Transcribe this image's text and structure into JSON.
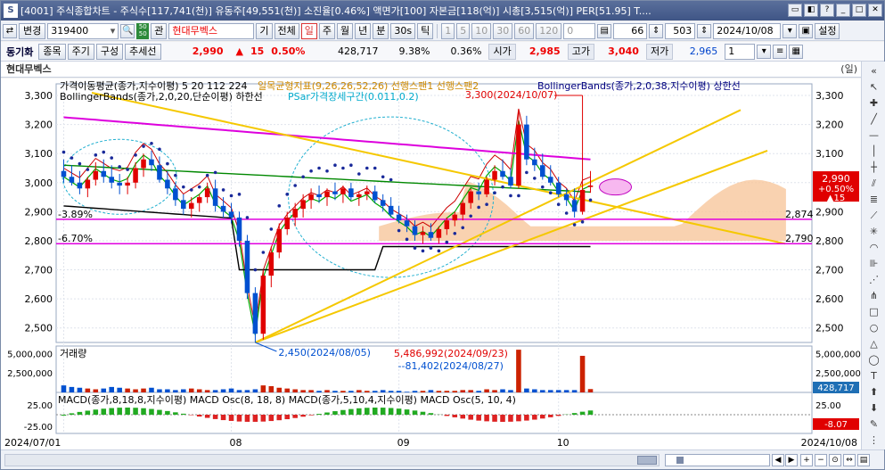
{
  "window": {
    "app_icon": "S",
    "title": "[4001] 주식종합차트 - 주식수[117,741(천)] 유동주[49,551(천)] 소진율[0.46%] 액면가[100] 자본금[118(억)] 시총[3,515(억)] PER[51.95] T...."
  },
  "toolbar1": {
    "change_label": "변경",
    "code": "319400",
    "market_top": "50",
    "market_bottom": "50",
    "gwan": "관",
    "stock_name": "현대무벡스",
    "gi": "기",
    "all": "전체",
    "periods": [
      "일",
      "주",
      "월",
      "년",
      "분",
      "30s",
      "틱"
    ],
    "intervals": [
      "1",
      "5",
      "10",
      "30",
      "60",
      "120",
      "0"
    ],
    "count_a": "66",
    "count_b": "503",
    "date": "2024/10/08",
    "settings": "설정"
  },
  "toolbar2": {
    "tag": "동기화",
    "buttons": [
      "종목",
      "주기",
      "구성",
      "추세선"
    ],
    "price": "2,990",
    "change_arrow": "▲",
    "change": "15",
    "change_rate": "0.50%",
    "volume": "428,717",
    "turnover": "9.38%",
    "vs_rate": "0.36%",
    "open_label": "시가",
    "open": "2,985",
    "high_label": "고가",
    "high": "3,040",
    "low_label": "저가",
    "low": "2,965",
    "page": "1"
  },
  "chart_header": {
    "stock": "현대무벡스",
    "unit": "(일)"
  },
  "chart_data": {
    "type": "candlestick",
    "title": "",
    "legend_main": [
      {
        "text": "가격이동평균(종가,지수이평) 5 20 112 224",
        "color": "#000000"
      },
      {
        "text": "일목균형지표(9,26,26,52,26) 선행스팬1 선행스팬2",
        "color": "#cc8800"
      },
      {
        "text": "BollingerBands(종가,2,0,38,지수이평) 상한선",
        "color": "#000080"
      },
      {
        "text": "BollingerBands(종가,2,0,20,단순이평) 하한선",
        "color": "#000000"
      },
      {
        "text": "PSar가격장세구간(0.011,0.2)",
        "color": "#00aacc"
      }
    ],
    "price_axis": [
      3300,
      3200,
      3100,
      3000,
      2900,
      2800,
      2700,
      2600,
      2500
    ],
    "price_ylim": [
      2450,
      3340
    ],
    "x_labels": [
      "2024/07/01",
      "08",
      "09",
      "10",
      "2024/10/08"
    ],
    "last_price": 2990,
    "last_change": "+0.50%",
    "last_delta": "▲15",
    "hlines": [
      {
        "label": "3.89%",
        "value": 2874,
        "value_label": "2,874"
      },
      {
        "label": "6.70%",
        "value": 2790,
        "value_label": "2,790"
      }
    ],
    "annotations": [
      {
        "text": "3,300(2024/10/07)",
        "value": 3300
      },
      {
        "text": "2,450(2024/08/05)",
        "value": 2450
      }
    ],
    "volume": {
      "label": "거래량",
      "axis": [
        "5,000,000",
        "2,500,000"
      ],
      "max_annotation": "5,486,992(2024/09/23)",
      "min_annotation": "81,402(2024/08/27)",
      "last": "428,717",
      "values": [
        900000,
        700000,
        600000,
        500000,
        400000,
        500000,
        700000,
        600000,
        500000,
        400000,
        500000,
        600000,
        400000,
        400000,
        300000,
        400000,
        500000,
        400000,
        300000,
        300000,
        400000,
        500000,
        300000,
        300000,
        400000,
        900000,
        800000,
        600000,
        500000,
        400000,
        300000,
        300000,
        200000,
        300000,
        200000,
        200000,
        200000,
        300000,
        200000,
        200000,
        300000,
        200000,
        200000,
        81402,
        200000,
        200000,
        300000,
        200000,
        200000,
        200000,
        300000,
        300000,
        200000,
        400000,
        300000,
        400000,
        300000,
        5486992,
        500000,
        400000,
        300000,
        300000,
        300000,
        300000,
        300000,
        4700000,
        428717
      ]
    },
    "macd": {
      "label": "MACD(종가,8,18,8,지수이평) MACD Osc(8, 18, 8) MACD(종가,5,10,4,지수이평) MACD Osc(5, 10, 4)",
      "axis": [
        "25.00",
        "-25.00"
      ],
      "last": "-8.07"
    },
    "candles": [
      [
        3040,
        3080,
        3000,
        3020
      ],
      [
        3020,
        3060,
        2990,
        3000
      ],
      [
        3000,
        3040,
        2960,
        2980
      ],
      [
        2980,
        3020,
        2950,
        3010
      ],
      [
        3010,
        3070,
        2990,
        3040
      ],
      [
        3040,
        3080,
        3000,
        3020
      ],
      [
        3020,
        3060,
        2980,
        3000
      ],
      [
        3000,
        3030,
        2960,
        2990
      ],
      [
        2990,
        3020,
        2960,
        3000
      ],
      [
        3000,
        3070,
        2980,
        3050
      ],
      [
        3050,
        3100,
        3020,
        3080
      ],
      [
        3080,
        3110,
        3040,
        3060
      ],
      [
        3060,
        3090,
        3000,
        3010
      ],
      [
        3010,
        3040,
        2960,
        2980
      ],
      [
        2980,
        3000,
        2920,
        2940
      ],
      [
        2940,
        2960,
        2890,
        2910
      ],
      [
        2910,
        2950,
        2880,
        2930
      ],
      [
        2930,
        2960,
        2900,
        2950
      ],
      [
        2950,
        3000,
        2930,
        2980
      ],
      [
        2980,
        3010,
        2900,
        2920
      ],
      [
        2920,
        2950,
        2880,
        2900
      ],
      [
        2900,
        2930,
        2860,
        2880
      ],
      [
        2880,
        2900,
        2780,
        2800
      ],
      [
        2800,
        2820,
        2600,
        2620
      ],
      [
        2620,
        2640,
        2450,
        2480
      ],
      [
        2480,
        2700,
        2460,
        2680
      ],
      [
        2680,
        2780,
        2640,
        2760
      ],
      [
        2760,
        2860,
        2740,
        2840
      ],
      [
        2840,
        2900,
        2820,
        2880
      ],
      [
        2880,
        2930,
        2850,
        2910
      ],
      [
        2910,
        2960,
        2880,
        2940
      ],
      [
        2940,
        2980,
        2910,
        2960
      ],
      [
        2960,
        2990,
        2930,
        2950
      ],
      [
        2950,
        2980,
        2920,
        2970
      ],
      [
        2970,
        3000,
        2940,
        2960
      ],
      [
        2960,
        2990,
        2930,
        2980
      ],
      [
        2980,
        3000,
        2940,
        2950
      ],
      [
        2950,
        2970,
        2920,
        2960
      ],
      [
        2960,
        2990,
        2940,
        2970
      ],
      [
        2970,
        2990,
        2930,
        2940
      ],
      [
        2940,
        2960,
        2900,
        2920
      ],
      [
        2920,
        2950,
        2880,
        2890
      ],
      [
        2890,
        2920,
        2860,
        2870
      ],
      [
        2870,
        2890,
        2830,
        2850
      ],
      [
        2850,
        2870,
        2800,
        2820
      ],
      [
        2820,
        2850,
        2790,
        2830
      ],
      [
        2830,
        2860,
        2800,
        2810
      ],
      [
        2810,
        2850,
        2790,
        2840
      ],
      [
        2840,
        2880,
        2820,
        2870
      ],
      [
        2870,
        2900,
        2850,
        2890
      ],
      [
        2890,
        2940,
        2870,
        2930
      ],
      [
        2930,
        2980,
        2910,
        2970
      ],
      [
        2970,
        3000,
        2940,
        2960
      ],
      [
        2960,
        3020,
        2950,
        3010
      ],
      [
        3010,
        3060,
        2990,
        3040
      ],
      [
        3040,
        3080,
        3010,
        3020
      ],
      [
        3020,
        3050,
        2980,
        2990
      ],
      [
        2990,
        3250,
        2980,
        3200
      ],
      [
        3200,
        3230,
        3060,
        3080
      ],
      [
        3080,
        3120,
        3040,
        3060
      ],
      [
        3060,
        3100,
        3010,
        3020
      ],
      [
        3020,
        3060,
        2990,
        3000
      ],
      [
        3000,
        3020,
        2950,
        2960
      ],
      [
        2960,
        2980,
        2920,
        2940
      ],
      [
        2940,
        2980,
        2880,
        2900
      ],
      [
        2900,
        3300,
        2890,
        2975
      ],
      [
        2985,
        3040,
        2965,
        2990
      ]
    ]
  }
}
